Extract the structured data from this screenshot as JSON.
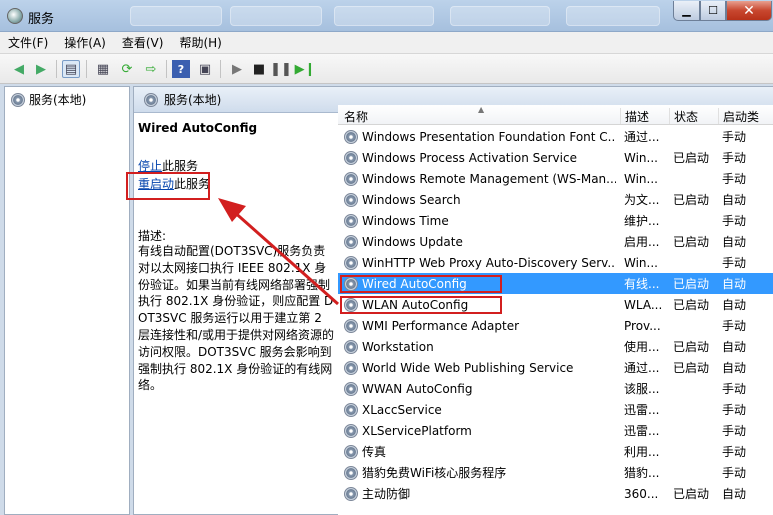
{
  "window": {
    "title": "服务",
    "controls": [
      "minimize",
      "maximize",
      "close"
    ]
  },
  "menu": [
    "文件(F)",
    "操作(A)",
    "查看(V)",
    "帮助(H)"
  ],
  "tree": {
    "item": "服务(本地)"
  },
  "header": {
    "title": "服务(本地)"
  },
  "selected_service": {
    "name": "Wired AutoConfig",
    "stop_link": "停止",
    "stop_suffix": "此服务",
    "restart_link": "重启动",
    "restart_suffix": "此服务",
    "desc_label": "描述:",
    "description": "有线自动配置(DOT3SVC)服务负责对以太网接口执行 IEEE 802.1X 身份验证。如果当前有线网络部署强制执行 802.1X 身份验证，则应配置 DOT3SVC 服务运行以用于建立第 2 层连接性和/或用于提供对网络资源的访问权限。DOT3SVC 服务会影响到强制执行 802.1X 身份验证的有线网络。"
  },
  "columns": [
    "名称",
    "描述",
    "状态",
    "启动类"
  ],
  "services": [
    {
      "name": "Windows Presentation Foundation Font C...",
      "desc": "通过...",
      "status": "",
      "start": "手动"
    },
    {
      "name": "Windows Process Activation Service",
      "desc": "Win...",
      "status": "已启动",
      "start": "手动"
    },
    {
      "name": "Windows Remote Management (WS-Man...",
      "desc": "Win...",
      "status": "",
      "start": "手动"
    },
    {
      "name": "Windows Search",
      "desc": "为文...",
      "status": "已启动",
      "start": "自动"
    },
    {
      "name": "Windows Time",
      "desc": "维护...",
      "status": "",
      "start": "手动"
    },
    {
      "name": "Windows Update",
      "desc": "启用...",
      "status": "已启动",
      "start": "自动"
    },
    {
      "name": "WinHTTP Web Proxy Auto-Discovery Serv...",
      "desc": "Win...",
      "status": "",
      "start": "手动"
    },
    {
      "name": "Wired AutoConfig",
      "desc": "有线...",
      "status": "已启动",
      "start": "自动"
    },
    {
      "name": "WLAN AutoConfig",
      "desc": "WLA...",
      "status": "已启动",
      "start": "自动"
    },
    {
      "name": "WMI Performance Adapter",
      "desc": "Prov...",
      "status": "",
      "start": "手动"
    },
    {
      "name": "Workstation",
      "desc": "使用...",
      "status": "已启动",
      "start": "自动"
    },
    {
      "name": "World Wide Web Publishing Service",
      "desc": "通过...",
      "status": "已启动",
      "start": "自动"
    },
    {
      "name": "WWAN AutoConfig",
      "desc": "该服...",
      "status": "",
      "start": "手动"
    },
    {
      "name": "XLaccService",
      "desc": "迅雷...",
      "status": "",
      "start": "手动"
    },
    {
      "name": "XLServicePlatform",
      "desc": "迅雷...",
      "status": "",
      "start": "手动"
    },
    {
      "name": "传真",
      "desc": "利用...",
      "status": "",
      "start": "手动"
    },
    {
      "name": "猎豹免费WiFi核心服务程序",
      "desc": "猎豹...",
      "status": "",
      "start": "手动"
    },
    {
      "name": "主动防御",
      "desc": "360...",
      "status": "已启动",
      "start": "自动"
    }
  ],
  "colors": {
    "selection": "#3399ff",
    "annotation": "#d21f1f",
    "link": "#0645ad"
  }
}
